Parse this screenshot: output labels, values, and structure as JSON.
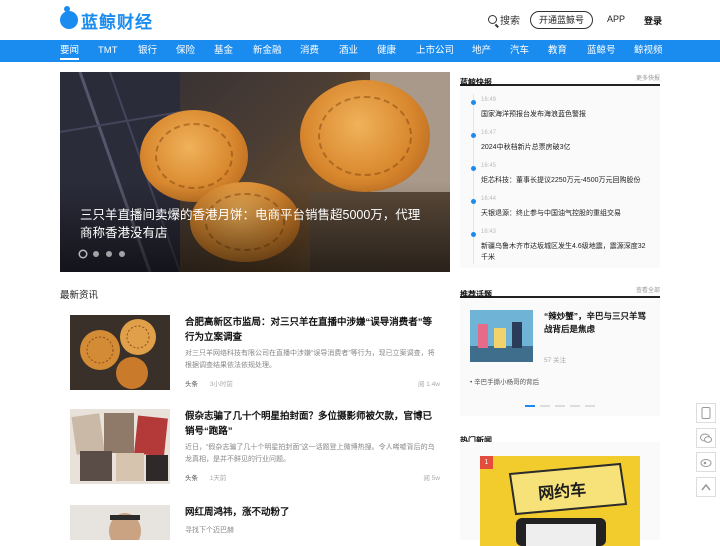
{
  "header": {
    "logo_text": "蓝鲸财经",
    "search_label": "搜索",
    "open_button": "开通蓝鲸号",
    "app_link": "APP",
    "login_link": "登录"
  },
  "nav": {
    "items": [
      "要闻",
      "TMT",
      "银行",
      "保险",
      "基金",
      "新金融",
      "消费",
      "酒业",
      "健康",
      "上市公司",
      "地产",
      "汽车",
      "教育",
      "蓝鲸号",
      "鲸视频"
    ]
  },
  "hero": {
    "title": "三只羊直播间卖爆的香港月饼：电商平台销售超5000万，代理商称香港没有店",
    "slide_count": 4,
    "active_slide": 1
  },
  "latest": {
    "title": "最新资讯",
    "articles": [
      {
        "title": "合肥高新区市监局：对三只羊在直播中涉嫌“误导消费者”等行为立案调查",
        "desc": "对三只羊网络科技有限公司在直播中涉嫌“误导消费者”等行为，现已立案调查，将根据调查结果依法依规处理。",
        "source": "头条",
        "time": "3小时前",
        "views": "阅 1.4w"
      },
      {
        "title": "假杂志骗了几十个明星拍封面？多位摄影师被欠款，官博已销号“跑路”",
        "desc": "近日，“假杂志骗了几十个明星拍封面”这一话题登上微博热搜。令人唏嘘背后的乌龙真相，是并不鲜见的行业问题。",
        "source": "头条",
        "time": "1天前",
        "views": "阅 5w"
      },
      {
        "title": "网红周鸿祎，涨不动粉了",
        "desc": "寻找下个迈巴赫",
        "source": "",
        "time": "",
        "views": ""
      }
    ]
  },
  "flash": {
    "title": "蓝鲸快报",
    "more": "更多快报",
    "items": [
      {
        "time": "16:49",
        "text": "国家海洋预报台发布海浪蓝色警报"
      },
      {
        "time": "16:47",
        "text": "2024中秋档新片总票房破3亿"
      },
      {
        "time": "16:45",
        "text": "炬芯科技：董事长提议2250万元-4500万元回购股份"
      },
      {
        "time": "16:44",
        "text": "天银退源：终止参与中国油气控股的重组交易"
      },
      {
        "time": "16:43",
        "text": "新疆乌鲁木齐市达坂城区发生4.6级地震，震源深度32千米"
      }
    ]
  },
  "topics": {
    "title": "推荐话题",
    "more": "查看全部",
    "main_title": "“辣炒蟹”，辛巴与三只羊骂战背后是焦虑",
    "count": "57 关注",
    "sub": "辛巴手撕小杨哥的背后",
    "dots": 5,
    "active_dot": 0
  },
  "hot": {
    "title": "热门新闻",
    "rank": "1",
    "sign_text": "网约车"
  },
  "floats": [
    "phone-icon",
    "wechat-icon",
    "weibo-icon",
    "up-icon"
  ],
  "colors": {
    "brand": "#1a8cf0",
    "rank_red": "#e34d3b"
  }
}
